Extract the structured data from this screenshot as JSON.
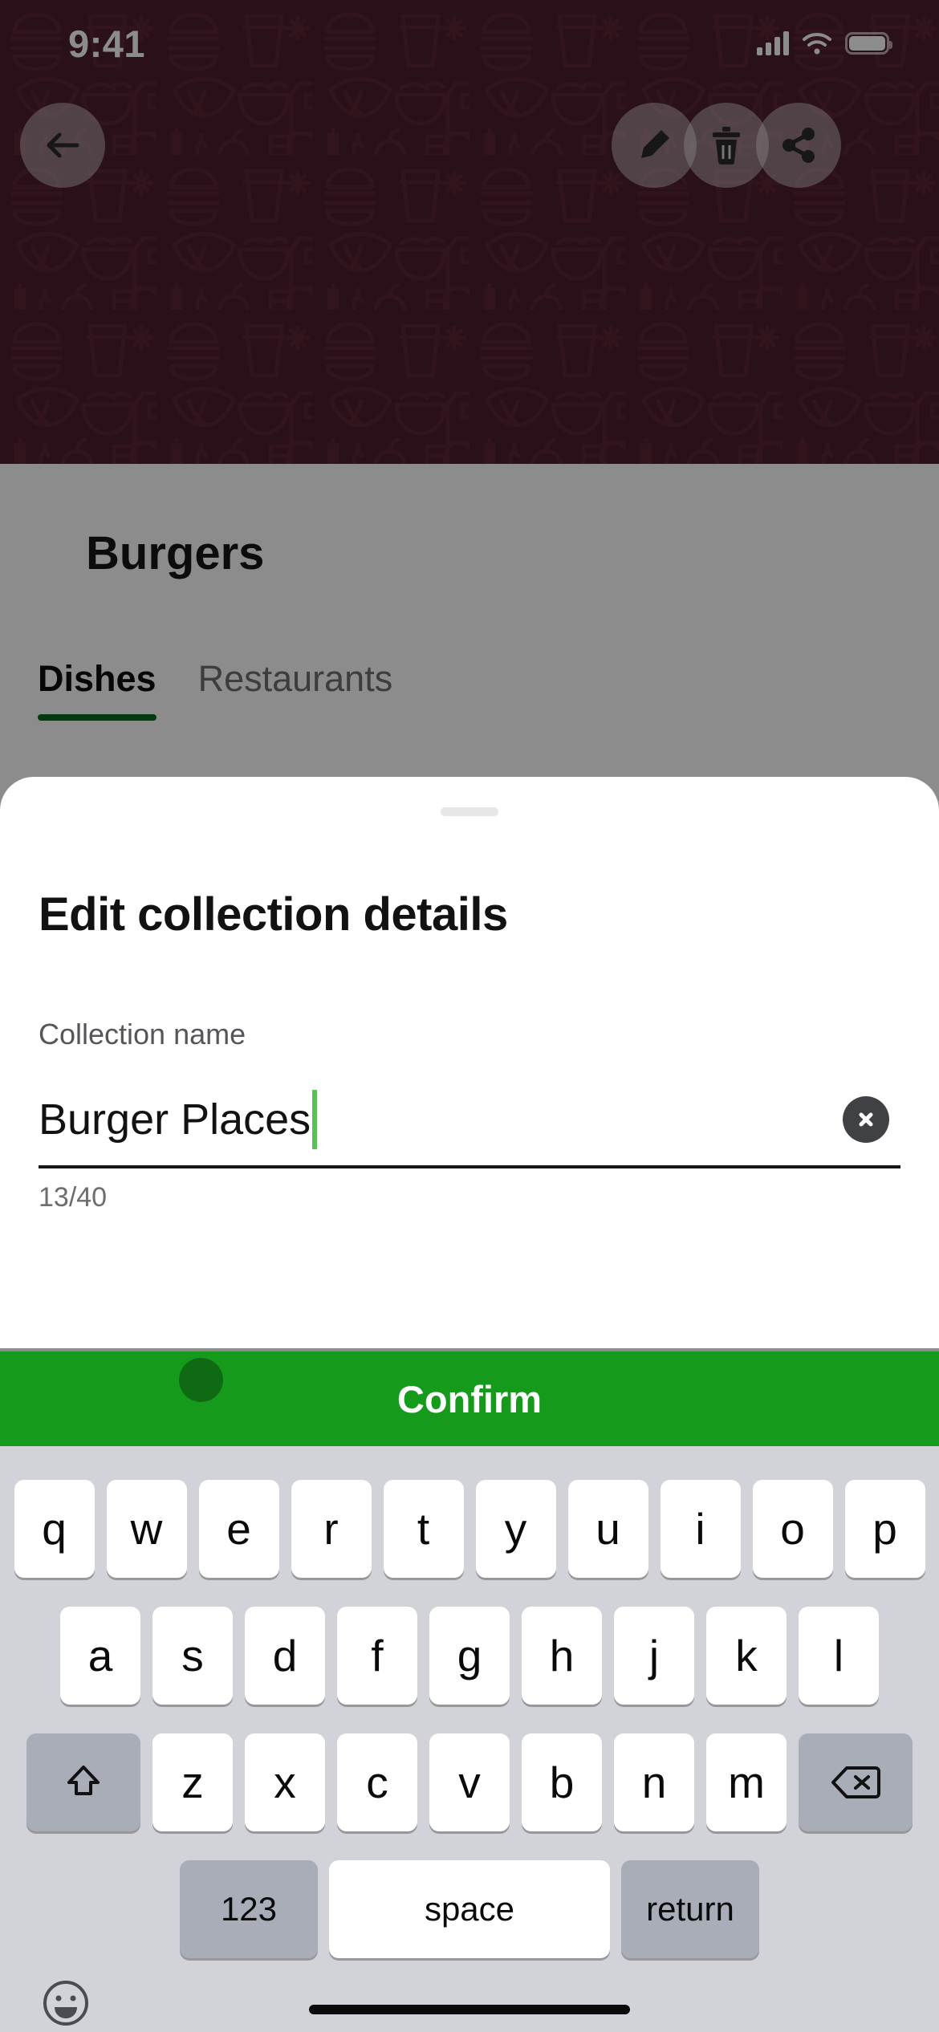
{
  "status_bar": {
    "time": "9:41",
    "signal_icon": "cellular-signal-icon",
    "wifi_icon": "wifi-icon",
    "battery_icon": "battery-icon"
  },
  "header": {
    "back_icon": "arrow-left-icon",
    "edit_icon": "pencil-icon",
    "delete_icon": "trash-icon",
    "share_icon": "share-icon",
    "background_color": "#4e1f2e",
    "pattern": "food-doodle-pattern"
  },
  "collection": {
    "title": "Burgers"
  },
  "tabs": [
    {
      "label": "Dishes",
      "active": true
    },
    {
      "label": "Restaurants",
      "active": false
    }
  ],
  "sheet": {
    "title": "Edit collection details",
    "field_label": "Collection name",
    "field_value": "Burger Places",
    "field_placeholder": "Collection name",
    "clear_icon": "close-circle-icon",
    "char_counter": "13/40",
    "confirm_label": "Confirm",
    "confirm_color": "#159a1c",
    "caret_color": "#57c257",
    "accent_color": "#046b1e"
  },
  "keyboard": {
    "row1": [
      "q",
      "w",
      "e",
      "r",
      "t",
      "y",
      "u",
      "i",
      "o",
      "p"
    ],
    "row2": [
      "a",
      "s",
      "d",
      "f",
      "g",
      "h",
      "j",
      "k",
      "l"
    ],
    "row3": [
      "z",
      "x",
      "c",
      "v",
      "b",
      "n",
      "m"
    ],
    "shift_icon": "shift-arrow-icon",
    "backspace_icon": "backspace-icon",
    "numbers_label": "123",
    "space_label": "space",
    "return_label": "return",
    "emoji_icon": "emoji-smiley-icon"
  }
}
